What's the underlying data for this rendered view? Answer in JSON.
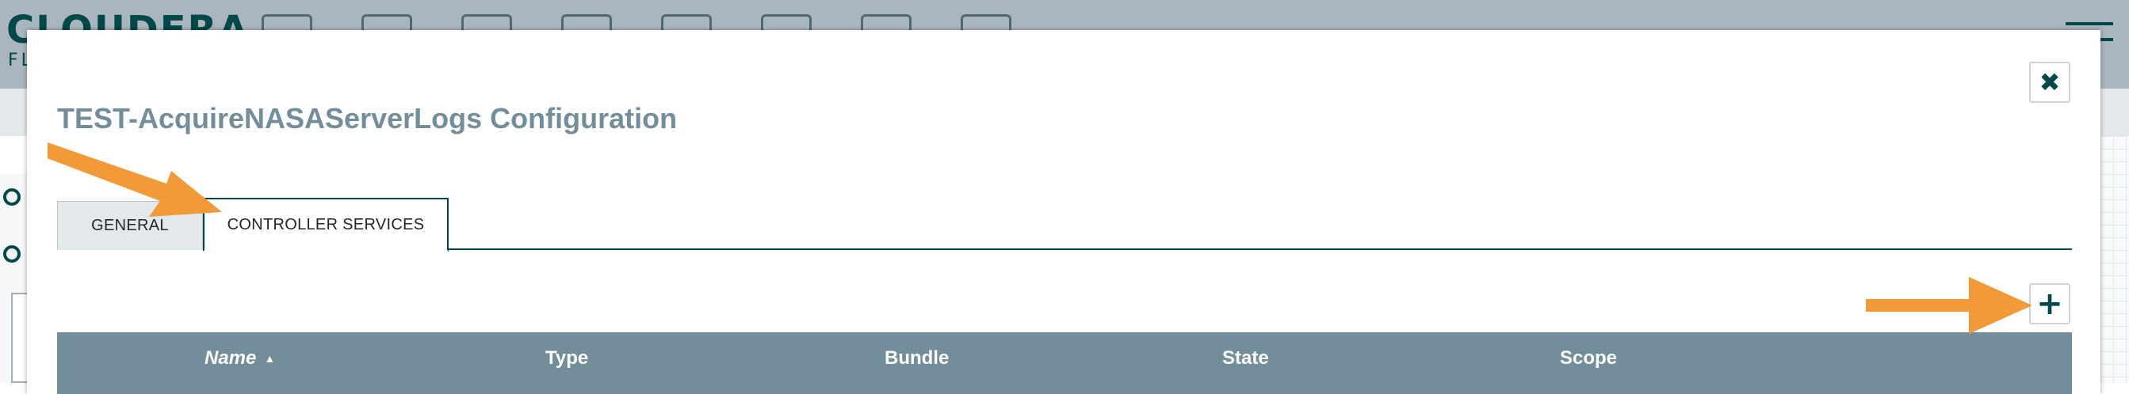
{
  "app": {
    "brand": "CLOUDERA",
    "brand_sub": "FLOW"
  },
  "dialog": {
    "title": "TEST-AcquireNASAServerLogs Configuration",
    "close_label": "✖",
    "tabs": [
      {
        "label": "GENERAL",
        "active": false
      },
      {
        "label": "CONTROLLER SERVICES",
        "active": true
      }
    ],
    "add_label": "+",
    "table": {
      "columns": [
        "Name",
        "Type",
        "Bundle",
        "State",
        "Scope"
      ],
      "sort_indicator": "▲",
      "rows": []
    }
  },
  "colors": {
    "header_bg": "#a9b6bf",
    "title": "#728e9b",
    "accent": "#004849",
    "grid_header": "#728e9b",
    "annotation_arrow": "#f29a38"
  }
}
